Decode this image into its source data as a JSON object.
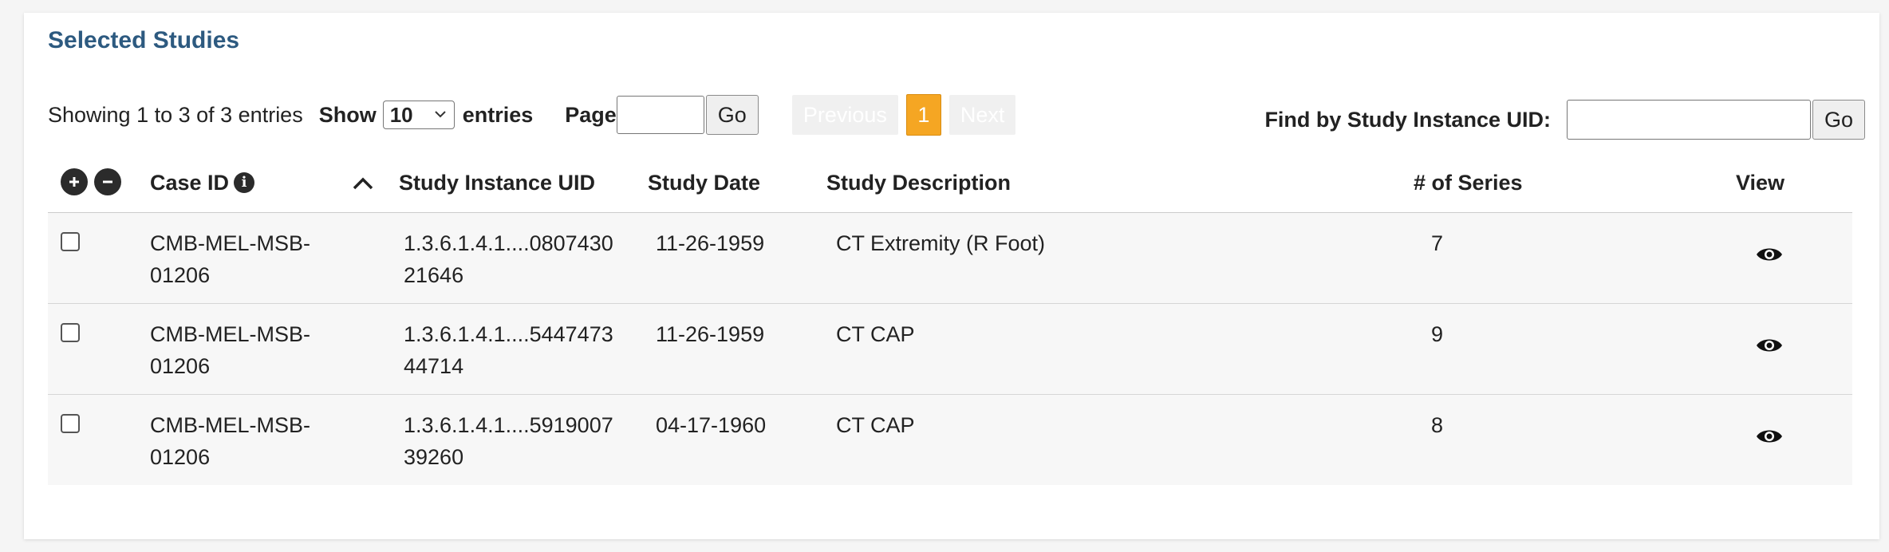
{
  "panel": {
    "title": "Selected Studies"
  },
  "controls": {
    "showing": "Showing 1 to 3 of 3 entries",
    "show_label": "Show",
    "entries_value": "10",
    "entries_label": "entries",
    "page_label": "Page",
    "page_value": "",
    "go_label": "Go",
    "prev_label": "Previous",
    "current_page": "1",
    "next_label": "Next",
    "find_label": "Find by Study Instance UID:",
    "find_value": "",
    "find_go_label": "Go"
  },
  "table": {
    "columns": {
      "case_id": "Case ID",
      "uid": "Study Instance UID",
      "date": "Study Date",
      "desc": "Study Description",
      "series": "# of Series",
      "view": "View"
    },
    "rows": [
      {
        "case_line1": "CMB-MEL-MSB-",
        "case_line2": "01206",
        "uid_line1": "1.3.6.1.4.1....0807430",
        "uid_line2": "21646",
        "date": "11-26-1959",
        "desc": "CT Extremity (R Foot)",
        "series": "7"
      },
      {
        "case_line1": "CMB-MEL-MSB-",
        "case_line2": "01206",
        "uid_line1": "1.3.6.1.4.1....5447473",
        "uid_line2": "44714",
        "date": "11-26-1959",
        "desc": "CT CAP",
        "series": "9"
      },
      {
        "case_line1": "CMB-MEL-MSB-",
        "case_line2": "01206",
        "uid_line1": "1.3.6.1.4.1....5919007",
        "uid_line2": "39260",
        "date": "04-17-1960",
        "desc": "CT CAP",
        "series": "8"
      }
    ]
  },
  "icons": {
    "expand_all": "plus-circle-icon",
    "collapse_all": "minus-circle-icon",
    "info": "info-icon",
    "sort": "chevron-up-icon",
    "view": "eye-icon"
  },
  "colors": {
    "title": "#2d5a80",
    "current_page_bg": "#f5a623",
    "disabled_page_bg": "#f0f0f0",
    "row_bg": "#f7f7f7"
  }
}
